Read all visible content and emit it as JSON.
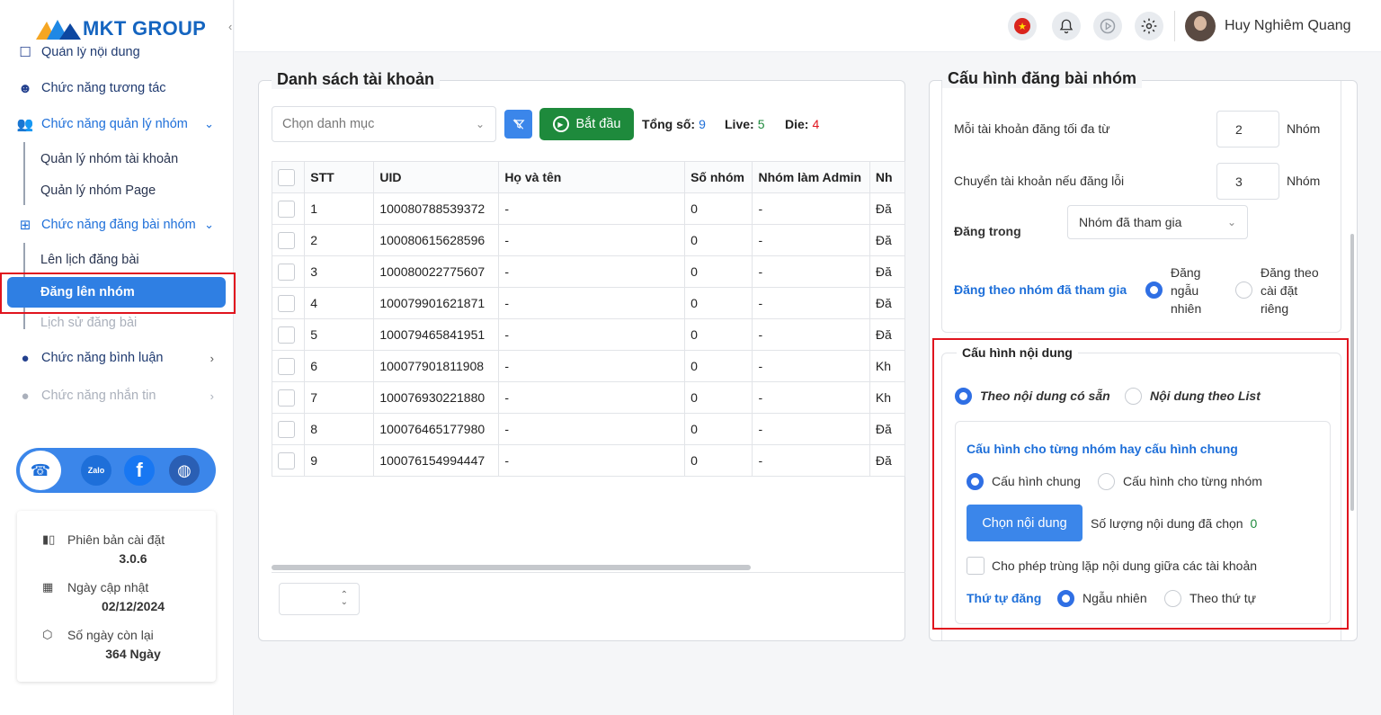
{
  "brand": {
    "name": "MKT GROUP",
    "collapse_icon": "chevron-left-icon"
  },
  "sidebar": {
    "items": [
      {
        "label": "Quản lý nội dung",
        "icon": "square-icon"
      },
      {
        "label": "Chức năng tương tác",
        "icon": "smile-icon"
      },
      {
        "label": "Chức năng quản lý nhóm",
        "icon": "group-icon"
      },
      {
        "label": "Chức năng đăng bài nhóm",
        "icon": "post-add-icon"
      },
      {
        "label": "Chức năng bình luận",
        "icon": "comment-icon"
      },
      {
        "label": "Chức năng nhắn tin",
        "icon": "chat-icon"
      }
    ],
    "group_sub": [
      "Quản lý nhóm tài khoản",
      "Quản lý nhóm Page"
    ],
    "post_sub": [
      "Lên lịch đăng bài",
      "Đăng lên nhóm",
      "Lịch sử đăng bài"
    ]
  },
  "social": {
    "zalo": "Zalo",
    "facebook": "f"
  },
  "info": {
    "version_label": "Phiên bản cài đặt",
    "version": "3.0.6",
    "update_label": "Ngày cập nhật",
    "update": "02/12/2024",
    "remain_label": "Số ngày còn lại",
    "remain": "364 Ngày"
  },
  "header": {
    "user_name": "Huy Nghiêm Quang",
    "flag_star": "★"
  },
  "accounts": {
    "title": "Danh sách tài khoản",
    "category_placeholder": "Chọn danh mục",
    "start_label": "Bắt đầu",
    "total_label": "Tổng số:",
    "total": "9",
    "live_label": "Live:",
    "live": "5",
    "die_label": "Die:",
    "die": "4",
    "columns": [
      "STT",
      "UID",
      "Họ và tên",
      "Số nhóm",
      "Nhóm làm Admin",
      "Nh"
    ],
    "rows": [
      [
        "1",
        "100080788539372",
        "-",
        "0",
        "-",
        "Đă"
      ],
      [
        "2",
        "100080615628596",
        "-",
        "0",
        "-",
        "Đă"
      ],
      [
        "3",
        "100080022775607",
        "-",
        "0",
        "-",
        "Đă"
      ],
      [
        "4",
        "100079901621871",
        "-",
        "0",
        "-",
        "Đă"
      ],
      [
        "5",
        "100079465841951",
        "-",
        "0",
        "-",
        "Đă"
      ],
      [
        "6",
        "100077901811908",
        "-",
        "0",
        "-",
        "Kh"
      ],
      [
        "7",
        "100076930221880",
        "-",
        "0",
        "-",
        "Kh"
      ],
      [
        "8",
        "100076465177980",
        "-",
        "0",
        "-",
        "Đă"
      ],
      [
        "9",
        "100076154994447",
        "-",
        "0",
        "-",
        "Đă"
      ]
    ]
  },
  "config": {
    "title": "Cấu hình đăng bài nhóm",
    "max_per_account_label": "Mỗi tài khoản đăng tối đa từ",
    "max_per_account": "2",
    "switch_on_error_label": "Chuyển tài khoản nếu đăng lỗi",
    "switch_on_error": "3",
    "unit": "Nhóm",
    "post_in_label": "Đăng trong",
    "post_in_value": "Nhóm đã tham gia",
    "joined_label": "Đăng theo nhóm đã tham gia",
    "random_label": [
      "Đăng",
      "ngẫu",
      "nhiên"
    ],
    "custom_label": [
      "Đăng theo",
      "cài đặt",
      "riêng"
    ],
    "content": {
      "title": "Cấu hình nội dung",
      "opt_available": "Theo nội dung có sẵn",
      "opt_list": "Nội dung theo List",
      "group_cfg_title": "Cấu hình cho từng nhóm hay cấu hình chung",
      "opt_common": "Cấu hình chung",
      "opt_each": "Cấu hình cho từng nhóm",
      "choose_btn": "Chọn nội dung",
      "selected_count_label": "Số lượng nội dung đã chọn",
      "selected_count": "0",
      "allow_duplicate": "Cho phép trùng lặp nội dung giữa các tài khoản",
      "order_label": "Thứ tự đăng",
      "order_random": "Ngẫu nhiên",
      "order_seq": "Theo thứ tự"
    }
  }
}
